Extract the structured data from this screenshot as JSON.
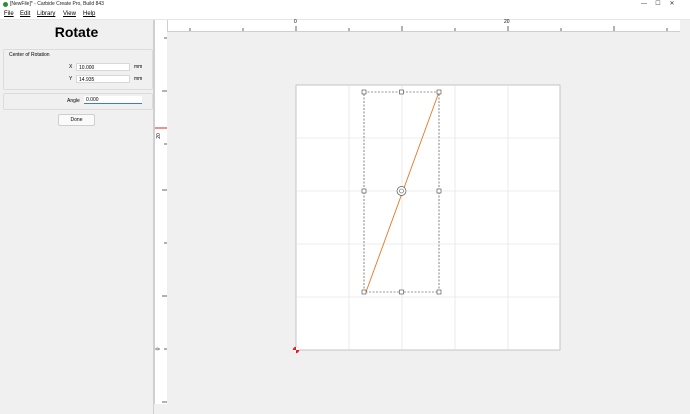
{
  "window": {
    "title": "[NewFile]* - Carbide Create Pro, Build 843",
    "app_icon": "carbide-logo-icon",
    "controls": {
      "minimize": "—",
      "maximize": "☐",
      "close": "✕"
    }
  },
  "menu": {
    "items": [
      {
        "label": "File"
      },
      {
        "label": "Edit"
      },
      {
        "label": "Library"
      },
      {
        "label": "View"
      },
      {
        "label": "Help"
      }
    ]
  },
  "panel": {
    "title": "Rotate",
    "center_label": "Center of Rotation",
    "x": {
      "label": "X",
      "value": "10.000",
      "unit": "mm"
    },
    "y": {
      "label": "Y",
      "value": "14.935",
      "unit": "mm"
    },
    "angle": {
      "label": "Angle",
      "value": "0.000"
    },
    "done_label": "Done"
  },
  "rulers": {
    "top_labels": [
      "0",
      "20"
    ],
    "left_labels": [
      "20",
      "0"
    ]
  },
  "colors": {
    "selection_line": "#e87722",
    "origin_marker": "#e02020",
    "grid": "#dddddd"
  }
}
